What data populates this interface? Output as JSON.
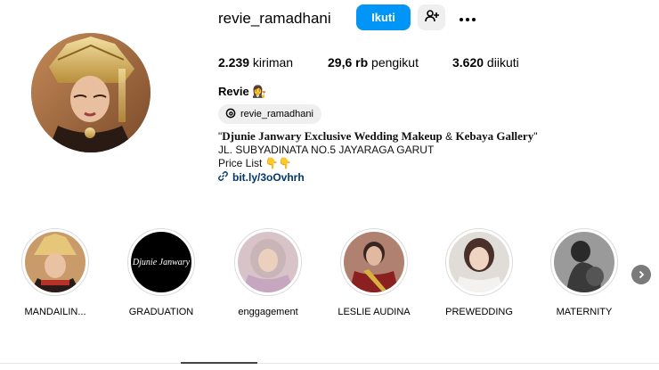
{
  "profile": {
    "username": "revie_ramadhani",
    "follow_label": "Ikuti",
    "suggest_icon": "add-person-icon",
    "more_icon": "more-options-icon",
    "avatar_desc": "woman wearing gold traditional headdress"
  },
  "stats": {
    "posts_count": "2.239",
    "posts_label": " kiriman",
    "followers_count": "29,6 rb",
    "followers_label": " pengikut",
    "following_count": "3.620",
    "following_label": " diikuti"
  },
  "bio": {
    "name": "Revie 👩‍⚖️",
    "threads_handle": "revie_ramadhani",
    "line1_q1": "\"",
    "line1_brand": "Djunie Janwary Exclusive Wedding Makeup",
    "line1_amp": " & ",
    "line1_brand2": "Kebaya Gallery",
    "line1_q2": "\"",
    "line2": "JL. SUBYADINATA NO.5 JAYARAGA GARUT",
    "line3": "Price List 👇👇",
    "link": "bit.ly/3oOvhrh"
  },
  "highlights": [
    {
      "label": "MANDAILIN..."
    },
    {
      "label": "GRADUATION",
      "logo_text": "Djunie Janwary"
    },
    {
      "label": "enggagement"
    },
    {
      "label": "LESLIE AUDINA"
    },
    {
      "label": "PREWEDDING"
    },
    {
      "label": "MATERNITY"
    }
  ],
  "colors": {
    "accent": "#0095f6",
    "link": "#00376b"
  }
}
